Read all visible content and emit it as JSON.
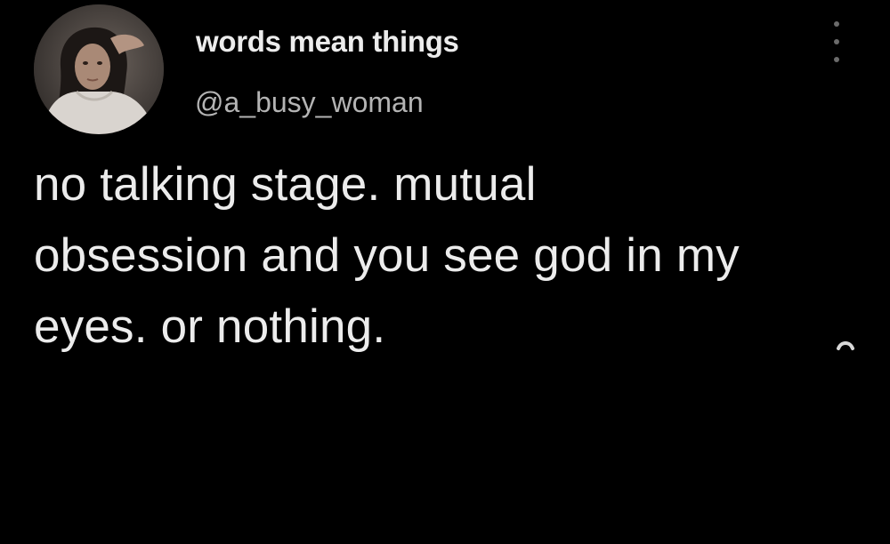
{
  "tweet": {
    "display_name": "words mean things",
    "handle": "@a_busy_woman",
    "text_lines": [
      "no talking stage. mutual",
      "obsession and you see god in my",
      "eyes. or nothing."
    ]
  },
  "icons": {
    "more": "more-vertical-icon",
    "caret": "caret-up-icon"
  },
  "colors": {
    "background": "#000000",
    "text": "#ececec",
    "handle": "#b4b4b4",
    "icon": "#6b6b6b"
  }
}
